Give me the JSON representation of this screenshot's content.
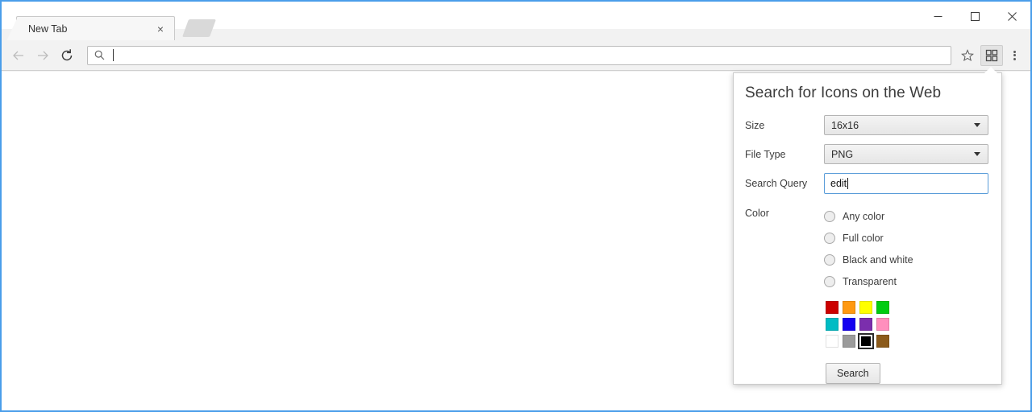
{
  "window": {
    "controls": {
      "minimize": "minimize",
      "maximize": "maximize",
      "close": "close"
    },
    "accent_color": "#4a9eea"
  },
  "tabs": [
    {
      "title": "New Tab",
      "close_label": "×"
    }
  ],
  "toolbar": {
    "back": "back",
    "forward": "forward",
    "reload": "reload",
    "omnibox": {
      "value": "",
      "placeholder": "",
      "icon": "search-icon"
    },
    "bookmark_star": "star-icon",
    "extension": "icon-search-extension",
    "menu": "chrome-menu"
  },
  "popup": {
    "title": "Search for Icons on the Web",
    "fields": {
      "size": {
        "label": "Size",
        "value": "16x16"
      },
      "file_type": {
        "label": "File Type",
        "value": "PNG"
      },
      "search_query": {
        "label": "Search Query",
        "value": "edit",
        "placeholder": ""
      },
      "color": {
        "label": "Color"
      }
    },
    "color_options": [
      {
        "label": "Any color",
        "selected": false
      },
      {
        "label": "Full color",
        "selected": false
      },
      {
        "label": "Black and white",
        "selected": false
      },
      {
        "label": "Transparent",
        "selected": false
      }
    ],
    "swatches": [
      {
        "name": "red",
        "hex": "#cc0000",
        "selected": false
      },
      {
        "name": "orange",
        "hex": "#ff9911",
        "selected": false
      },
      {
        "name": "yellow",
        "hex": "#ffff00",
        "selected": false
      },
      {
        "name": "green",
        "hex": "#00cc11",
        "selected": false
      },
      {
        "name": "teal",
        "hex": "#00bcc4",
        "selected": false
      },
      {
        "name": "blue",
        "hex": "#1400f0",
        "selected": false
      },
      {
        "name": "purple",
        "hex": "#7b2ead",
        "selected": false
      },
      {
        "name": "pink",
        "hex": "#ff8fbd",
        "selected": false
      },
      {
        "name": "white",
        "hex": "#ffffff",
        "selected": false
      },
      {
        "name": "gray",
        "hex": "#9b9b9b",
        "selected": false
      },
      {
        "name": "black",
        "hex": "#000000",
        "selected": true
      },
      {
        "name": "brown",
        "hex": "#8b5a1a",
        "selected": false
      }
    ],
    "search_button": "Search"
  }
}
